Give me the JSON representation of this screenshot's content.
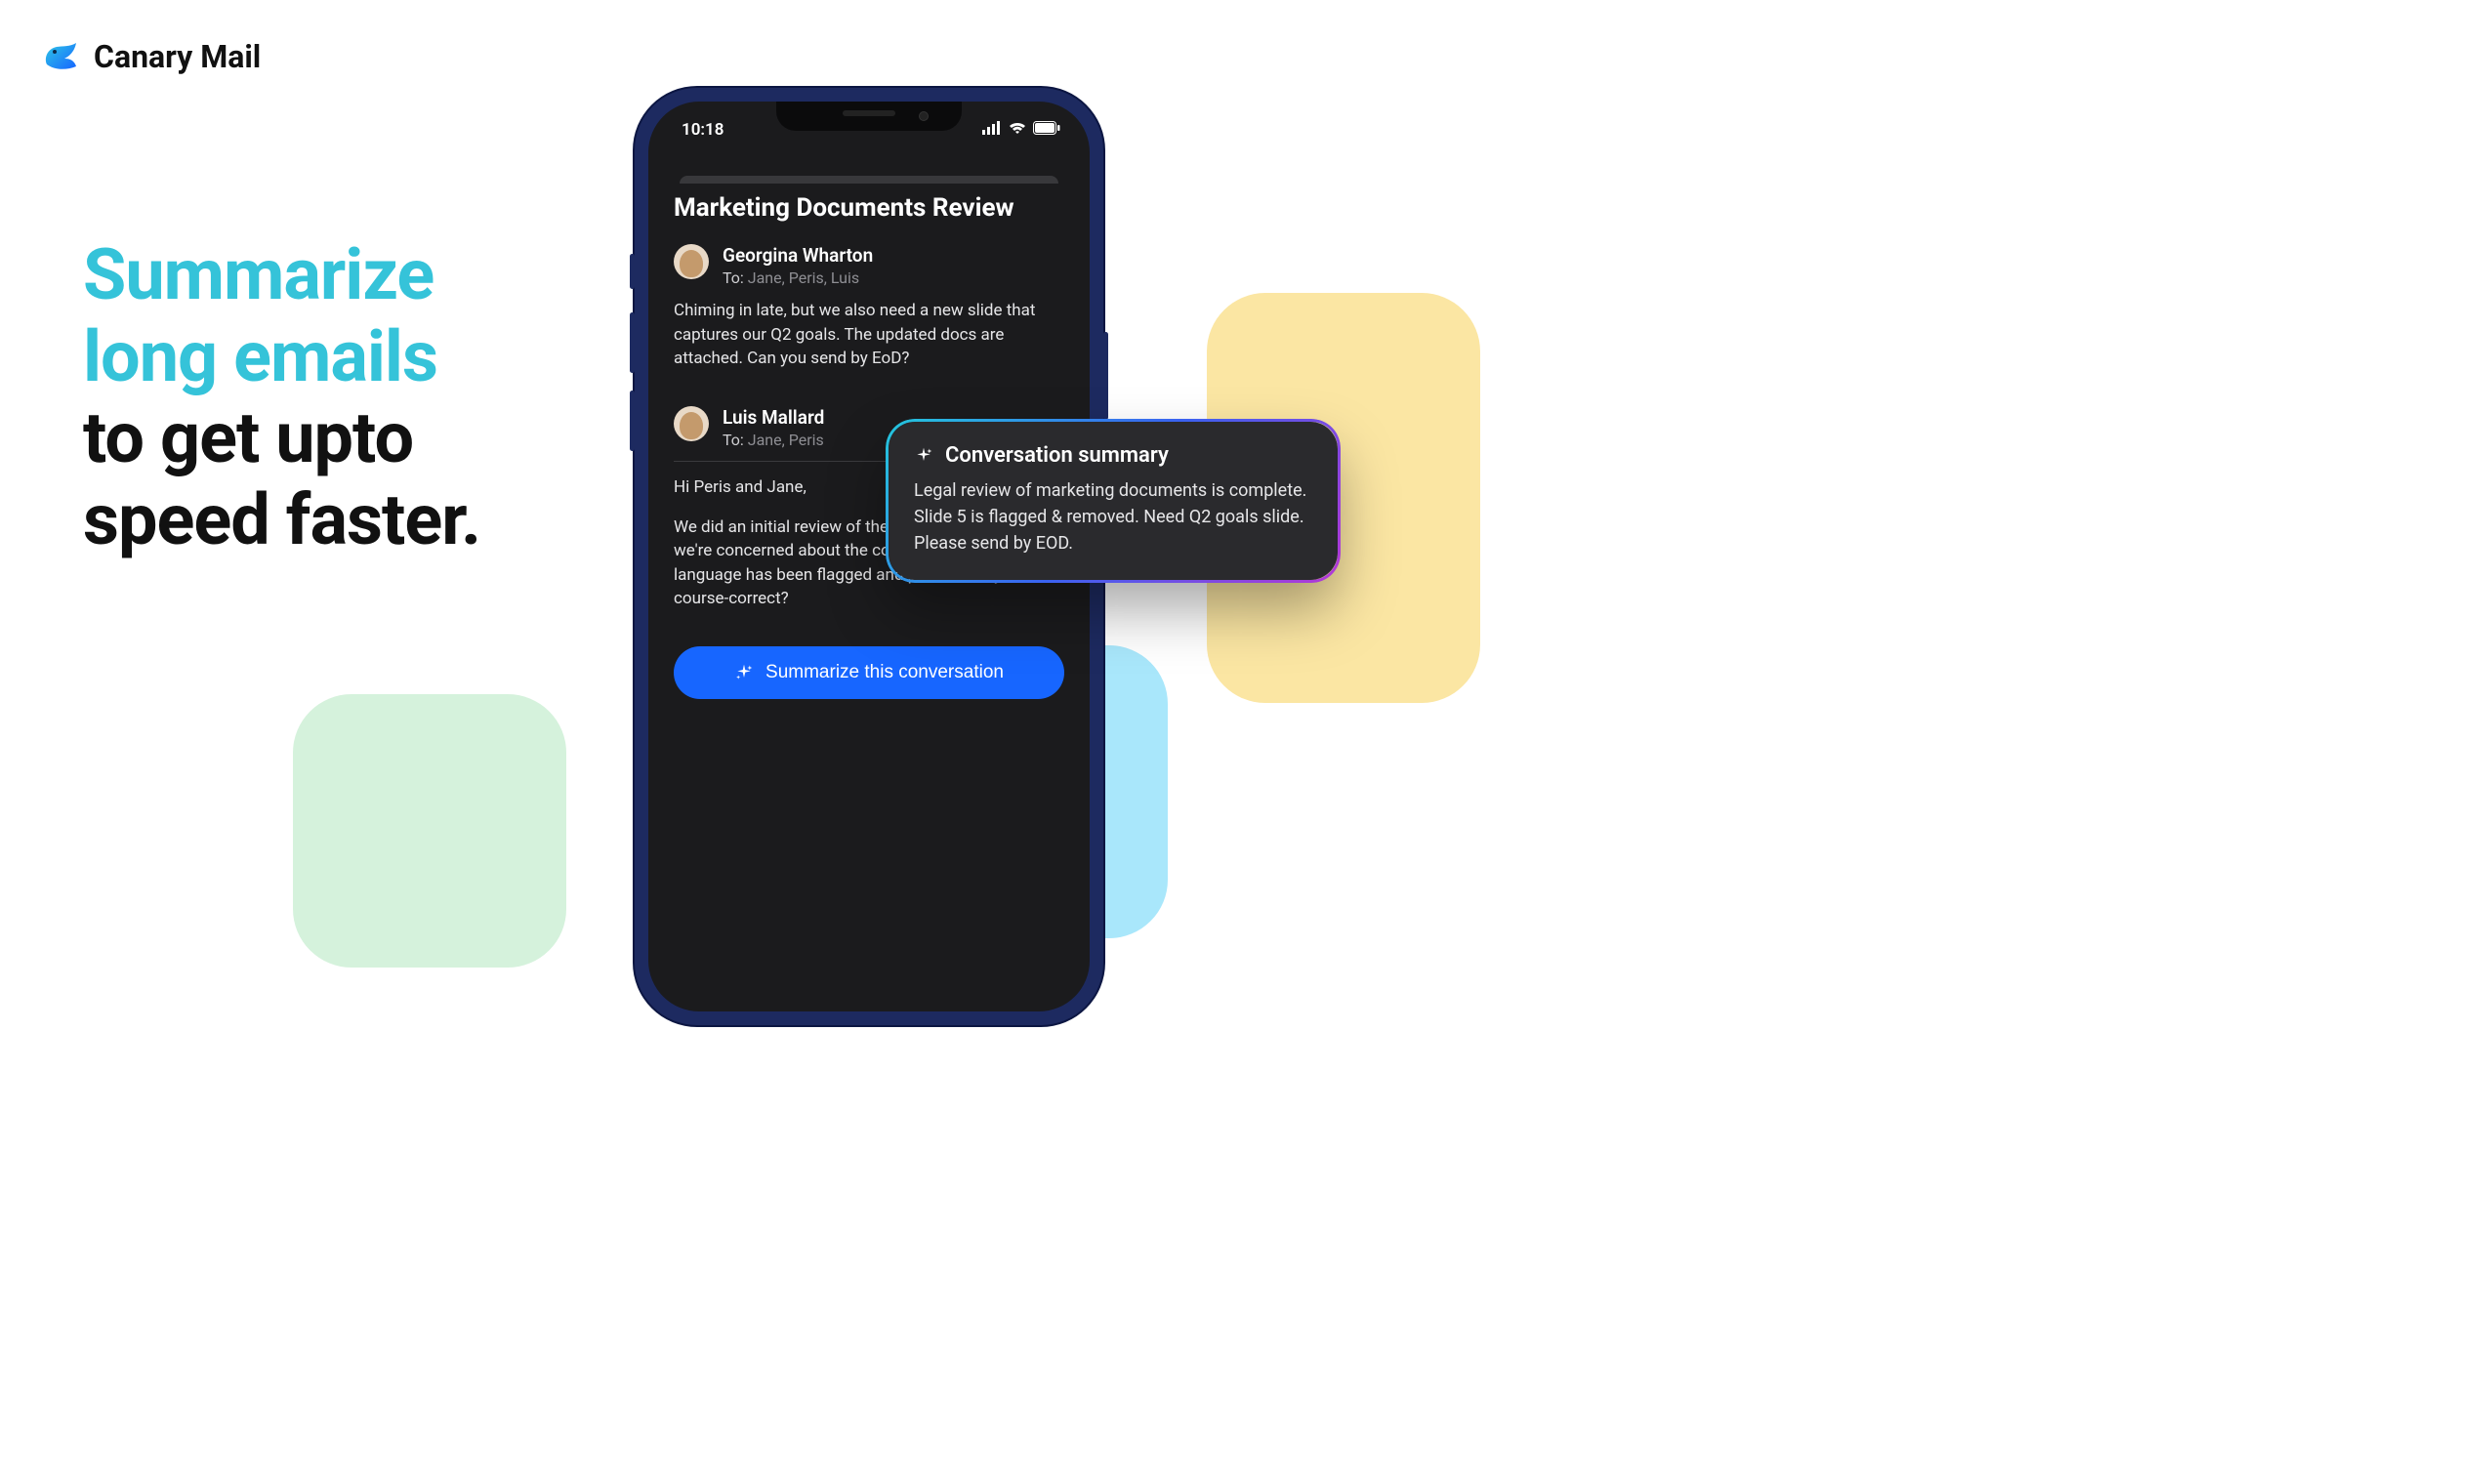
{
  "brand": {
    "name": "Canary Mail"
  },
  "headline": {
    "line1": "Summarize",
    "line2": "long emails",
    "line3": "to get upto",
    "line4": "speed faster."
  },
  "phone": {
    "status": {
      "time": "10:18"
    },
    "thread": {
      "subject": "Marketing Documents Review",
      "messages": [
        {
          "sender": "Georgina Wharton",
          "to_label": "To:",
          "recipients": "Jane,  Peris,  Luis",
          "body": "Chiming in late, but we also need a new slide that captures our Q2 goals. The updated docs are attached. Can you send by EoD?"
        },
        {
          "sender": "Luis Mallard",
          "to_label": "To:",
          "recipients": "Jane,  Peris",
          "greeting": "Hi Peris and Jane,",
          "body": "We did an initial review of the marketing deck, but we're concerned about the content in slide 5. That language has been flagged and pulled. Can you all course-correct?"
        }
      ],
      "summarize_button": "Summarize this conversation"
    }
  },
  "summary": {
    "title": "Conversation summary",
    "body": "Legal review of marketing documents is complete. Slide 5 is flagged & removed. Need Q2 goals slide. Please send by EOD."
  }
}
